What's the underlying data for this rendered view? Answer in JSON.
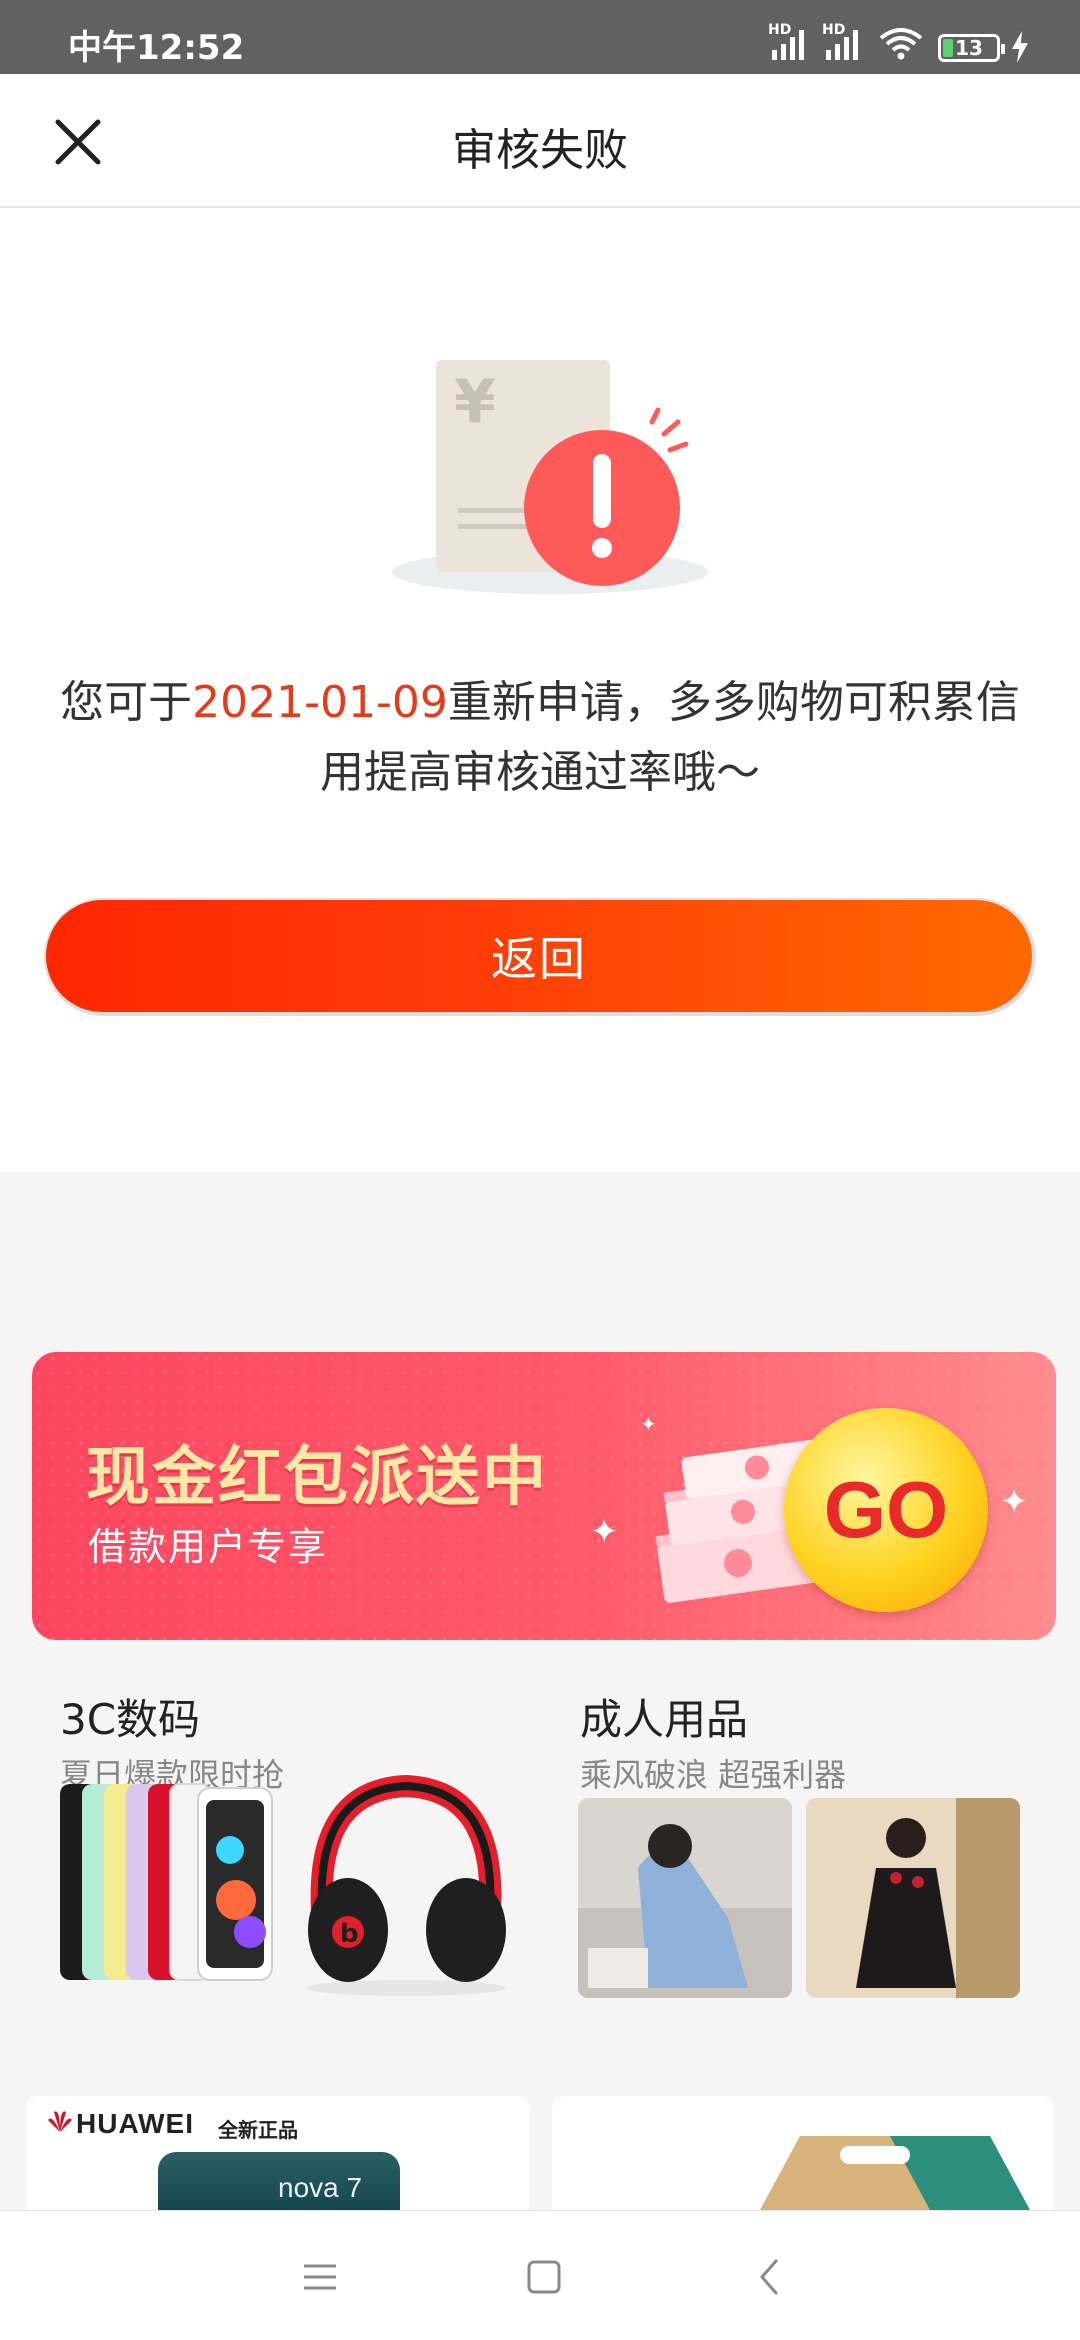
{
  "status_bar": {
    "time": "中午12:52",
    "signal1_label": "HD",
    "signal2_label": "HD",
    "battery_level": "13"
  },
  "header": {
    "title": "审核失败"
  },
  "message": {
    "prefix": "您可于",
    "date": "2021-01-09",
    "suffix": "重新申请，多多购物可积累信用提高审核通过率哦～"
  },
  "back_button": {
    "label": "返回"
  },
  "banner": {
    "title": "现金红包派送中",
    "subtitle": "借款用户专享",
    "go_label": "GO"
  },
  "categories": [
    {
      "name": "3C数码",
      "tagline": "夏日爆款限时抢"
    },
    {
      "name": "成人用品",
      "tagline": "乘风破浪 超强利器"
    }
  ],
  "products": {
    "brand": "HUAWEI",
    "brand_tag": "全新正品",
    "model": "nova 7"
  },
  "colors": {
    "accent_red": "#e63a1a",
    "button_gradient_start": "#ff2600",
    "button_gradient_end": "#ff6a00",
    "banner_red": "#fc4660",
    "status_bar_bg": "#616161"
  },
  "icons": {
    "close": "close-icon",
    "wifi": "wifi-icon",
    "nav_menu": "menu-icon",
    "nav_home": "home-icon",
    "nav_back": "back-icon"
  }
}
